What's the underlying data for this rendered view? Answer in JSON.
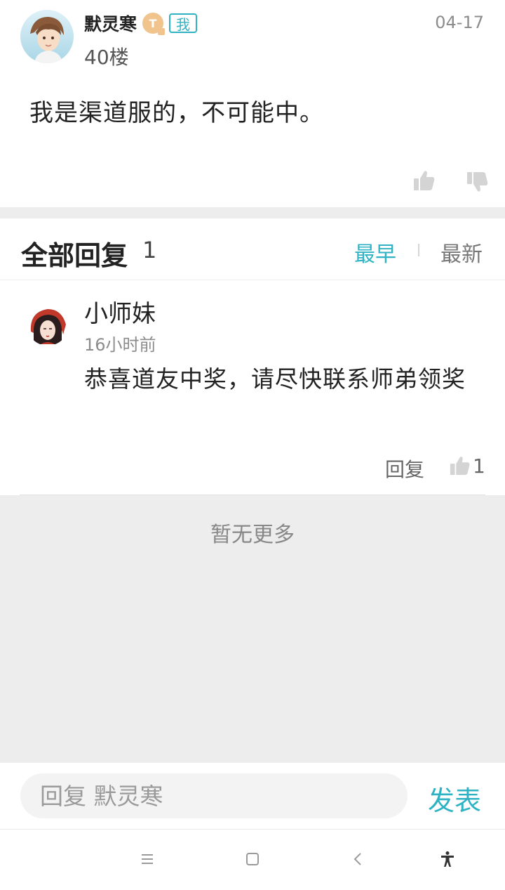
{
  "post": {
    "author": "默灵寒",
    "level_badge": "T",
    "me_badge": "我",
    "floor": "40楼",
    "date": "04-17",
    "content": "我是渠道服的，不可能中。"
  },
  "replies": {
    "title": "全部回复",
    "count": "1",
    "sort_earliest": "最早",
    "sort_newest": "最新",
    "items": [
      {
        "author": "小师妹",
        "time": "16小时前",
        "text": "恭喜道友中奖，请尽快联系师弟领奖",
        "reply_label": "回复",
        "likes": "1"
      }
    ],
    "no_more": "暂无更多"
  },
  "input_bar": {
    "placeholder": "回复 默灵寒",
    "send_label": "发表"
  },
  "colors": {
    "accent": "#2fb3c4",
    "background": "#ededed",
    "badge_gold": "#f1c48e"
  },
  "icons": {
    "like": "thumbs-up-icon",
    "dislike": "thumbs-down-icon",
    "nav_menu": "menu-icon",
    "nav_home": "home-square-icon",
    "nav_back": "back-chevron-icon",
    "nav_accessibility": "accessibility-icon"
  }
}
